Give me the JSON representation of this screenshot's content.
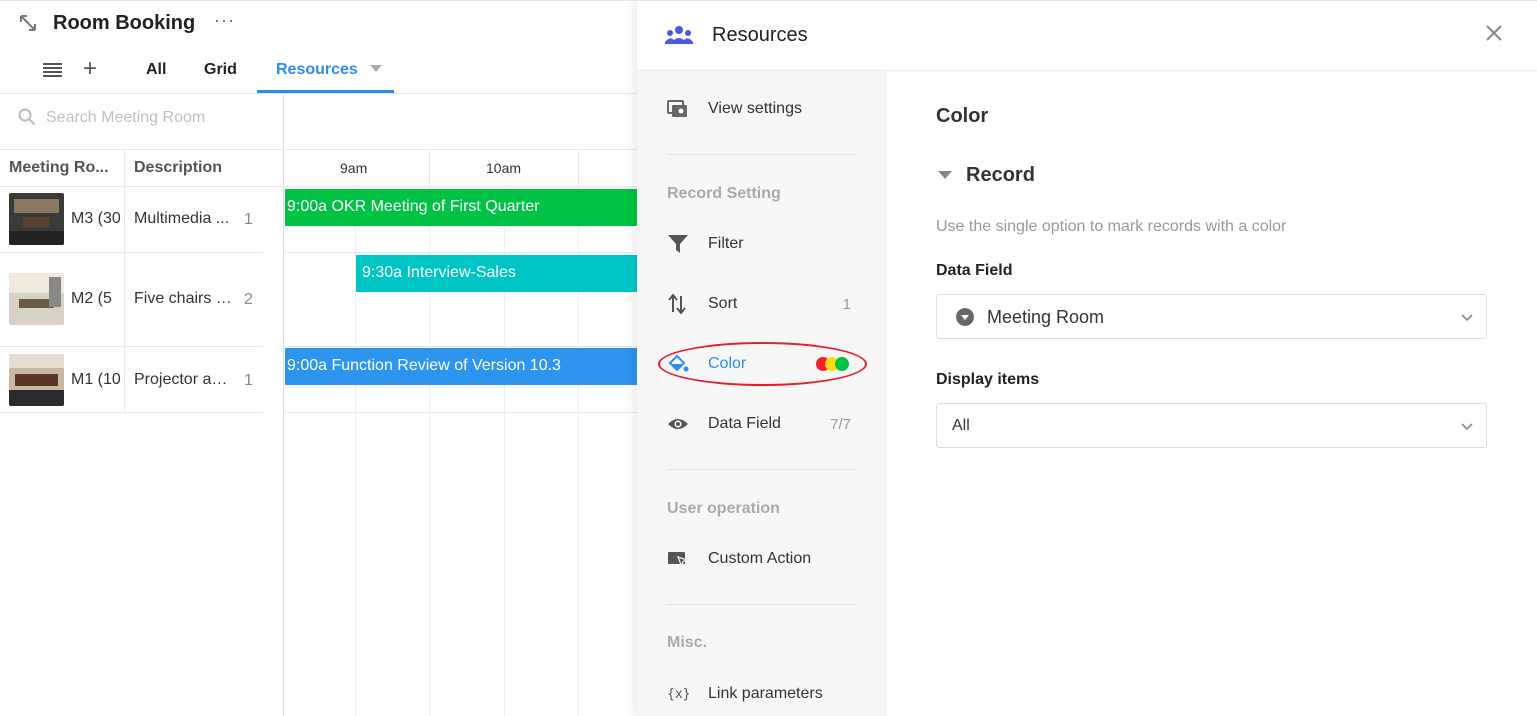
{
  "app": {
    "title": "Room Booking",
    "more_label": "···"
  },
  "viewbar": {
    "tabs": [
      "All",
      "Grid",
      "Resources"
    ],
    "active_tab": "Resources"
  },
  "search": {
    "placeholder": "Search Meeting Room"
  },
  "grid": {
    "headers": [
      "Meeting Ro...",
      "Description"
    ],
    "rows": [
      {
        "name": "M3 (30",
        "description": "Multimedia ...",
        "count": "1"
      },
      {
        "name": "M2 (5",
        "description": "Five chairs a...",
        "count": "2"
      },
      {
        "name": "M1 (10",
        "description": "Projector ava...",
        "count": "1"
      }
    ]
  },
  "timeline": {
    "times": [
      "9am",
      "10am"
    ],
    "events": [
      {
        "label": "9:00a OKR Meeting of First Quarter",
        "color": "#00c245"
      },
      {
        "label": "9:30a Interview-Sales",
        "color": "#00c5c5"
      },
      {
        "label": "9:00a Function Review of Version 10.3",
        "color": "#2d94f0"
      }
    ]
  },
  "panel": {
    "title": "Resources",
    "nav": {
      "view_settings": "View settings",
      "group_record": "Record Setting",
      "filter": "Filter",
      "sort": "Sort",
      "sort_count": "1",
      "color": "Color",
      "data_field": "Data Field",
      "data_field_count": "7/7",
      "group_user": "User operation",
      "custom_action": "Custom Action",
      "group_misc": "Misc.",
      "link_parameters": "Link parameters"
    },
    "content": {
      "section_title": "Color",
      "record_title": "Record",
      "hint": "Use the single option to mark records with a color",
      "data_field_label": "Data Field",
      "data_field_value": "Meeting Room",
      "display_items_label": "Display items",
      "display_items_value": "All"
    },
    "color_dots": [
      "#f5222d",
      "#fadb14",
      "#00c245"
    ],
    "accent": "#2d8cf0"
  }
}
